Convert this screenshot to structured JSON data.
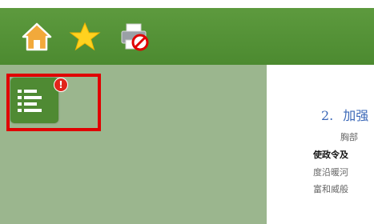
{
  "toolbar": {
    "buttons": [
      {
        "icon": "home-icon"
      },
      {
        "icon": "star-icon"
      },
      {
        "icon": "printer-disabled-icon"
      }
    ]
  },
  "sidebar": {
    "toc_button": {
      "icon": "table-of-contents-icon"
    },
    "alert_badge": "!"
  },
  "document": {
    "heading_number": "2.",
    "heading_text": "加强",
    "lines": [
      "胸部",
      "使政令及",
      "度沿暖河",
      "富和威般"
    ]
  },
  "colors": {
    "toolbar": "#4f8e33",
    "sidebar": "#9bb68e",
    "highlight": "#e00000",
    "badge": "#e1251b",
    "heading": "#3b68b8"
  }
}
